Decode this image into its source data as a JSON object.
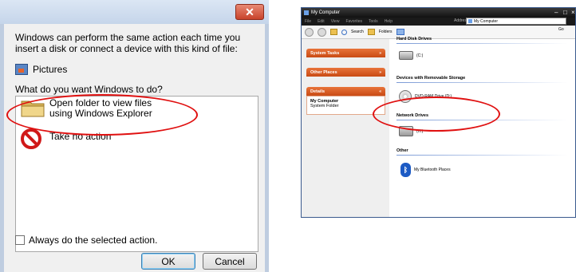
{
  "autoplay_dialog": {
    "close_label": "✕",
    "description": "Windows can perform the same action each time you insert a disk or connect a device with this kind of file:",
    "content_type": "Pictures",
    "question": "What do you want Windows to do?",
    "options": [
      {
        "line1": "Open folder to view files",
        "line2": "using Windows Explorer",
        "icon": "folder-icon"
      },
      {
        "line1": "Take no action",
        "icon": "no-entry-icon"
      }
    ],
    "always_label": "Always do the selected action.",
    "ok_label": "OK",
    "cancel_label": "Cancel",
    "highlight_color": "#e01010"
  },
  "my_computer": {
    "title": "My Computer",
    "menu": [
      "File",
      "Edit",
      "View",
      "Favorites",
      "Tools",
      "Help"
    ],
    "address_label": "Address",
    "address_value": "My Computer",
    "go_label": "Go",
    "toolbar": {
      "search": "Search",
      "folders": "Folders"
    },
    "left_panel": {
      "system_tasks": "System Tasks",
      "other_places": "Other Places",
      "details": "Details",
      "details_title": "My Computer",
      "details_sub": "System Folder"
    },
    "groups": {
      "hard_disk": "Hard Disk Drives",
      "removable": "Devices with Removable Storage",
      "network": "Network Drives",
      "other": "Other"
    },
    "items": {
      "c_drive": "(C:)",
      "dvd_drive": "DVD-RAM Drive (D:)",
      "network_drive": "(H:)",
      "bluetooth": "My Bluetooth Places"
    },
    "accent_color": "#d9581c"
  }
}
